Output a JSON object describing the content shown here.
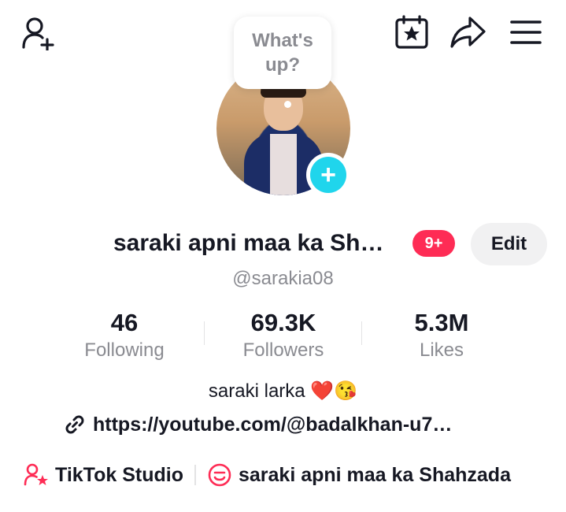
{
  "header": {
    "add_friend_icon": "person-plus-icon",
    "calendar_icon": "calendar-star-icon",
    "share_icon": "share-arrow-icon",
    "menu_icon": "hamburger-menu-icon"
  },
  "bubble": {
    "text": "What's up?"
  },
  "profile": {
    "display_name": "saraki apni maa ka Sh…",
    "notification_badge": "9+",
    "edit_label": "Edit",
    "handle": "@sarakia08"
  },
  "stats": [
    {
      "value": "46",
      "label": "Following"
    },
    {
      "value": "69.3K",
      "label": "Followers"
    },
    {
      "value": "5.3M",
      "label": "Likes"
    }
  ],
  "bio": "saraki larka ❤️😘",
  "link": "https://youtube.com/@badalkhan-u7…",
  "bottom": {
    "studio_label": "TikTok Studio",
    "studio_icon": "person-star-icon",
    "playlist_label": "saraki apni maa ka Shahzada",
    "playlist_icon": "playlist-icon"
  },
  "colors": {
    "accent": "#fe2c55",
    "plus": "#20d5ec",
    "muted": "#8a8b91"
  }
}
